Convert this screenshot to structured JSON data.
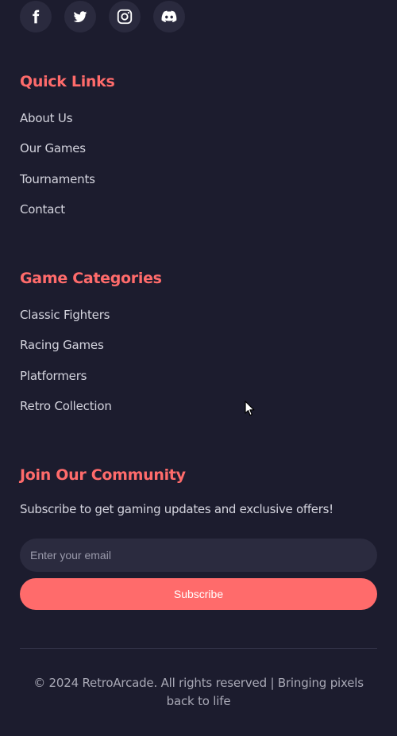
{
  "footer": {
    "socials": [
      {
        "icon": "facebook-icon"
      },
      {
        "icon": "twitter-icon"
      },
      {
        "icon": "instagram-icon"
      },
      {
        "icon": "discord-icon"
      }
    ],
    "quick_links": {
      "title": "Quick Links",
      "items": [
        "About Us",
        "Our Games",
        "Tournaments",
        "Contact"
      ]
    },
    "game_categories": {
      "title": "Game Categories",
      "items": [
        "Classic Fighters",
        "Racing Games",
        "Platformers",
        "Retro Collection"
      ]
    },
    "community": {
      "title": "Join Our Community",
      "text": "Subscribe to get gaming updates and exclusive offers!",
      "email_placeholder": "Enter your email",
      "email_value": "",
      "subscribe_label": "Subscribe"
    },
    "copyright": "© 2024 RetroArcade. All rights reserved | Bringing pixels back to life"
  },
  "colors": {
    "background": "#1c1c2e",
    "accent": "#ff6b6b",
    "social_button": "#2a2a3e",
    "input_background": "#2b2b3f",
    "text": "#d4d4de",
    "muted_text": "#a9a9b6"
  }
}
